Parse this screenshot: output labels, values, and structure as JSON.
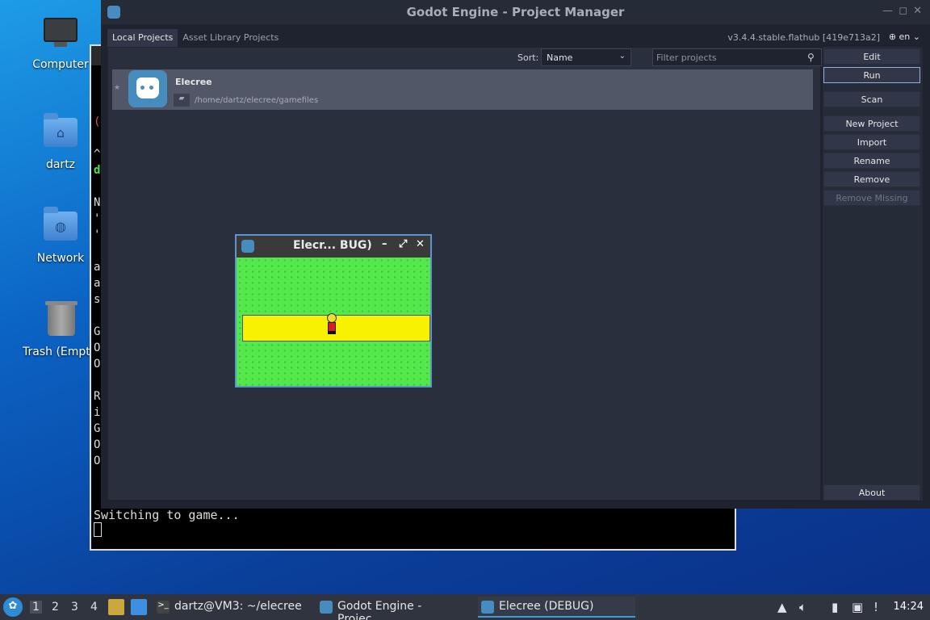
{
  "desktop": {
    "icons": [
      {
        "label": "Computer"
      },
      {
        "label": "dartz"
      },
      {
        "label": "Network"
      },
      {
        "label": "Trash (Empt"
      }
    ]
  },
  "terminal": {
    "visible_chars": [
      "(",
      "^",
      "d",
      "N",
      "'",
      "'",
      "a",
      "a",
      "s",
      "G",
      "O",
      "O",
      "R",
      "i",
      "G",
      "O",
      "O"
    ],
    "last_line": "Switching to game..."
  },
  "godot": {
    "title": "Godot Engine - Project Manager",
    "tabs": [
      "Local Projects",
      "Asset Library Projects"
    ],
    "version": "v3.4.4.stable.flathub [419e713a2]",
    "language": "en",
    "sort_label": "Sort:",
    "sort_value": "Name",
    "filter_placeholder": "Filter projects",
    "project": {
      "name": "Elecree",
      "path": "/home/dartz/elecree/gamefiles"
    },
    "buttons": {
      "edit": "Edit",
      "run": "Run",
      "scan": "Scan",
      "new_project": "New Project",
      "import": "Import",
      "rename": "Rename",
      "remove": "Remove",
      "remove_missing": "Remove Missing",
      "about": "About"
    }
  },
  "game_window": {
    "title": "Elecr... BUG)"
  },
  "taskbar": {
    "workspaces": [
      "1",
      "2",
      "3",
      "4"
    ],
    "tasks": [
      {
        "label": "dartz@VM3: ~/elecree"
      },
      {
        "label": "Godot Engine - Projec..."
      },
      {
        "label": "Elecree (DEBUG)"
      }
    ],
    "clock": "14:24"
  },
  "colors": {
    "godot_blue": "#478cbf",
    "grass": "#55e84d",
    "road": "#f6f200",
    "focus_border": "#8fb0e0"
  }
}
